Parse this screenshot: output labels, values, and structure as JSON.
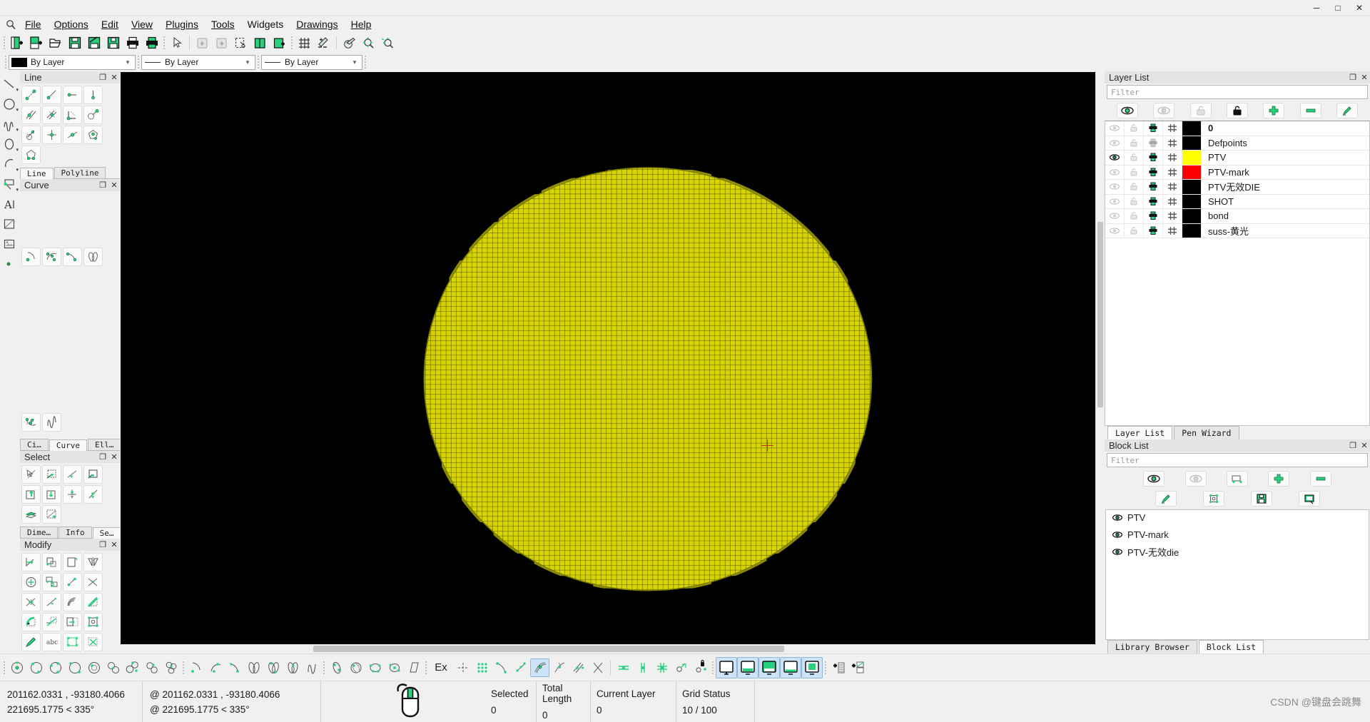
{
  "window": {
    "minimize": "─",
    "maximize": "□",
    "close": "✕"
  },
  "menubar": {
    "items": [
      {
        "label": "File",
        "accel_index": 0
      },
      {
        "label": "Options",
        "accel_index": 0
      },
      {
        "label": "Edit",
        "accel_index": 0
      },
      {
        "label": "View",
        "accel_index": 0
      },
      {
        "label": "Plugins",
        "accel_index": 2
      },
      {
        "label": "Tools",
        "accel_index": 0
      },
      {
        "label": "Widgets",
        "accel_index": 0
      },
      {
        "label": "Drawings",
        "accel_index": 0
      },
      {
        "label": "Help",
        "accel_index": 0
      }
    ]
  },
  "toolbar": {
    "groups": [
      {
        "name": "file",
        "buttons": [
          "new-file-icon",
          "new-from-template-icon",
          "open-folder-icon",
          "save-icon",
          "save-as-icon",
          "save-all-icon",
          "print-icon",
          "print-preview-icon"
        ]
      },
      {
        "name": "edit",
        "buttons": [
          "pointer-icon",
          "undo-icon",
          "redo-icon",
          "cut-icon",
          "copy-icon",
          "paste-icon"
        ]
      },
      {
        "name": "view",
        "buttons": [
          "grid-icon",
          "draw-order-icon",
          "pen-icon",
          "zoom-in-icon",
          "zoom-auto-icon"
        ]
      }
    ]
  },
  "attributes": {
    "layer_color": {
      "value": "By Layer",
      "swatch": "#000000"
    },
    "line_type": {
      "value": "By Layer"
    },
    "line_width": {
      "value": "By Layer"
    },
    "arrow": "▾"
  },
  "left_strip": {
    "tools": [
      "line-tool-icon",
      "circle-tool-icon",
      "spline-tool-icon",
      "ellipse-tool-icon",
      "arc-tool-icon",
      "polyline-tool-icon",
      "text-tool-icon",
      "hatch-tool-icon",
      "image-tool-icon",
      "point-tool-icon"
    ]
  },
  "left_docks": [
    {
      "title": "Line",
      "name": "line-dock",
      "tool_count": 13,
      "tabs": [
        {
          "label": "Line",
          "selected": true
        },
        {
          "label": "Polyline",
          "selected": false
        }
      ]
    },
    {
      "title": "Curve",
      "name": "curve-dock",
      "tool_count": 7,
      "tabs": [
        {
          "label": "Ci…",
          "selected": false
        },
        {
          "label": "Curve",
          "selected": true
        },
        {
          "label": "Ell…",
          "selected": false
        }
      ]
    },
    {
      "title": "Select",
      "name": "select-dock",
      "tool_count": 10,
      "tabs": [
        {
          "label": "Dime…",
          "selected": false
        },
        {
          "label": "Info",
          "selected": false
        },
        {
          "label": "Se…",
          "selected": true
        }
      ]
    },
    {
      "title": "Modify",
      "name": "modify-dock",
      "tool_count": 20,
      "tabs": []
    }
  ],
  "dock_buttons": {
    "float": "❐",
    "close": "✕"
  },
  "layer_list": {
    "title": "Layer List",
    "filter_placeholder": "Filter",
    "toolbar_icons": [
      "show-all-layers-icon",
      "hide-all-layers-icon",
      "unlock-all-layers-icon",
      "lock-all-layers-icon",
      "add-layer-icon",
      "remove-layer-icon",
      "edit-layer-icon"
    ],
    "columns": [
      "visible",
      "lock",
      "print",
      "construction",
      "color",
      "name"
    ],
    "rows": [
      {
        "name": "0",
        "color": "#000000",
        "visible": false,
        "current": true
      },
      {
        "name": "Defpoints",
        "color": "#000000",
        "visible": false,
        "current": false
      },
      {
        "name": "PTV",
        "color": "#ffff00",
        "visible": true,
        "current": false
      },
      {
        "name": "PTV-mark",
        "color": "#ff0000",
        "visible": false,
        "current": false
      },
      {
        "name": "PTV无效DIE",
        "color": "#000000",
        "visible": false,
        "current": false
      },
      {
        "name": "SHOT",
        "color": "#000000",
        "visible": false,
        "current": false
      },
      {
        "name": "bond",
        "color": "#000000",
        "visible": false,
        "current": false
      },
      {
        "name": "suss-黄光",
        "color": "#000000",
        "visible": false,
        "current": false
      }
    ],
    "tabs": [
      {
        "label": "Layer List",
        "selected": true
      },
      {
        "label": "Pen Wizard",
        "selected": false
      }
    ]
  },
  "block_list": {
    "title": "Block List",
    "filter_placeholder": "Filter",
    "toolbar_icons_row1": [
      "show-all-blocks-icon",
      "hide-all-blocks-icon",
      "insert-block-icon",
      "add-block-icon",
      "remove-block-icon"
    ],
    "toolbar_icons_row2": [
      "edit-block-icon",
      "create-block-icon",
      "save-block-icon",
      "export-block-icon"
    ],
    "rows": [
      {
        "name": "PTV",
        "visible": true
      },
      {
        "name": "PTV-mark",
        "visible": true
      },
      {
        "name": "PTV-无效die",
        "visible": true
      }
    ],
    "tabs": [
      {
        "label": "Library Browser",
        "selected": false
      },
      {
        "label": "Block List",
        "selected": true
      }
    ]
  },
  "bottom_toolbar": {
    "circle_tools": [
      "circle-center-point-icon",
      "circle-2points-icon",
      "circle-3points-icon",
      "circle-cr-icon",
      "circle-tangent-icon",
      "circle-tan2-icon",
      "circle-tan3-icon",
      "circle-concentric-icon",
      "circle-tan-tan-icon"
    ],
    "curve_tools": [
      "arc-center-icon",
      "arc-3points-icon",
      "arc-tangential-icon",
      "ellipse-axis-icon",
      "ellipse-arc-icon",
      "ellipse-foci-icon",
      "spline-icon"
    ],
    "ellipse_tools": [
      "ellipse-center-icon",
      "ellipse-inscribed-icon",
      "ellipse-4point-icon",
      "ellipse-center-3p-icon",
      "parallelogram-icon"
    ],
    "snap_label": "Ex",
    "snap_tools": [
      "snap-free-icon",
      "snap-grid-icon",
      "snap-endpoint-icon",
      "snap-onentity-icon",
      "snap-center-icon",
      "snap-middle-icon",
      "snap-distance-icon",
      "snap-intersection-icon"
    ],
    "restrict_tools": [
      "restrict-horizontal-icon",
      "restrict-vertical-icon",
      "restrict-orthogonal-icon",
      "relative-zero-icon",
      "lock-relative-zero-icon"
    ],
    "view_tools": [
      "view-single-icon",
      "view-bottom-icon",
      "view-top-icon",
      "view-split-h-icon",
      "view-full-icon"
    ],
    "extra_tools": [
      "add-layer-quick-icon",
      "add-block-quick-icon"
    ],
    "active_snap_index": 5
  },
  "status_bar": {
    "absolute_coord": "201162.0331 , -93180.4066",
    "absolute_polar": "221695.1775 < 335°",
    "relative_coord": "@  201162.0331 , -93180.4066",
    "relative_polar": "@  221695.1775 < 335°",
    "mouse_icon": "mouse-hint-icon",
    "fields": [
      {
        "header": "Selected",
        "value": "0"
      },
      {
        "header": "Total Length",
        "value": "0"
      },
      {
        "header": "Current Layer",
        "value": "0"
      },
      {
        "header": "Grid Status",
        "value": "10 / 100"
      }
    ],
    "watermark": "CSDN @键盘会跳舞"
  },
  "drawing": {
    "description": "wafer-map-die-grid",
    "fill_color": "#d8d400",
    "grid_color": "#4a4a00",
    "background": "#000000"
  }
}
